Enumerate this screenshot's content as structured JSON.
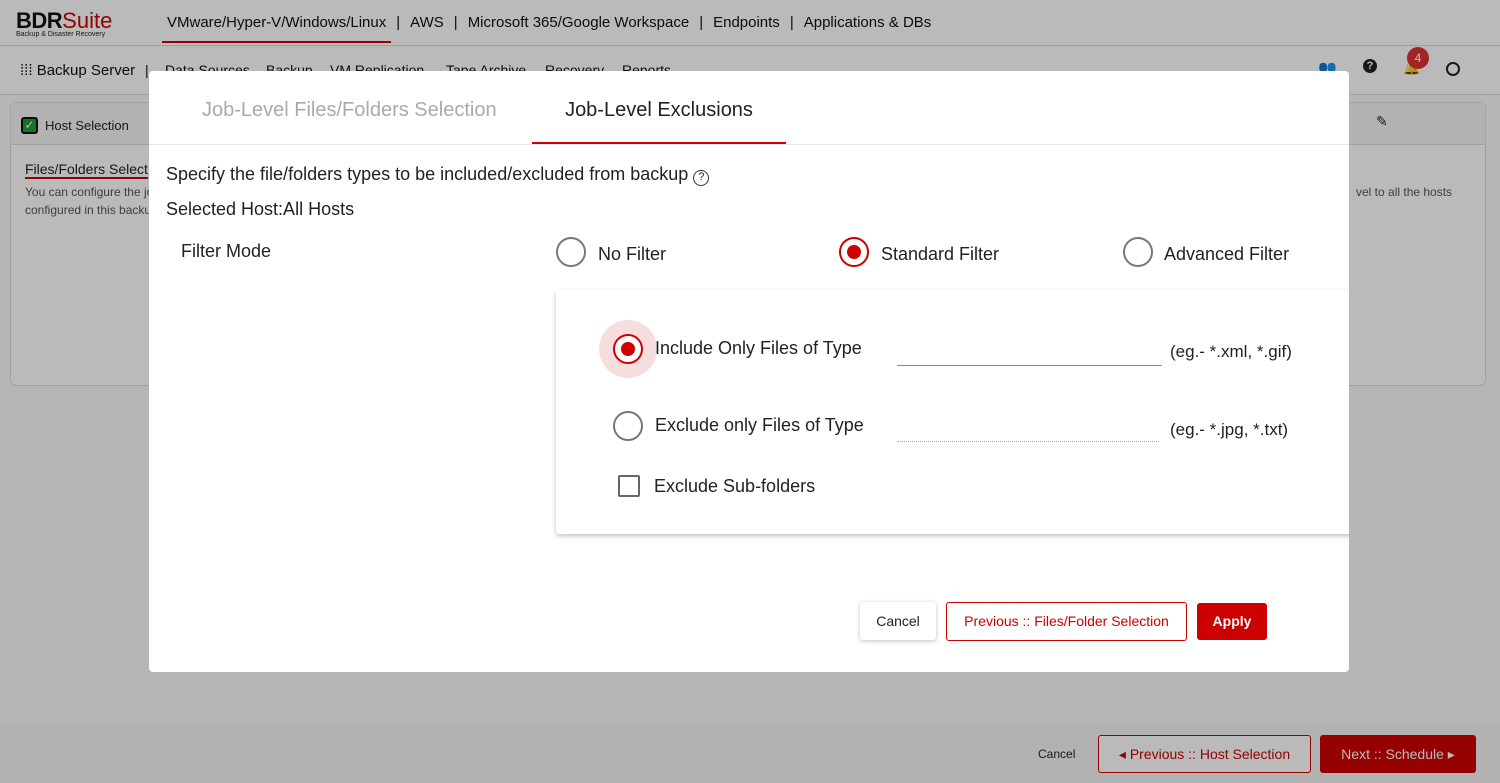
{
  "brand": {
    "name_bold": "BDR",
    "name_light": "Suite",
    "tagline": "Backup & Disaster Recovery"
  },
  "topnav": [
    "VMware/Hyper-V/Windows/Linux",
    "AWS",
    "Microsoft 365/Google Workspace",
    "Endpoints",
    "Applications & DBs"
  ],
  "subnav": {
    "home": "Backup Server",
    "items": [
      "Data Sources",
      "Backup",
      "VM Replication",
      "Tape Archive",
      "Recovery",
      "Reports"
    ]
  },
  "notifications": {
    "count": "4"
  },
  "wizard": {
    "step": "Host Selection",
    "section_title": "Files/Folders Select",
    "desc1": "You can configure the jo",
    "desc2": "configured in this backu",
    "desc_right": "vel to all the hosts"
  },
  "footer": {
    "cancel": "Cancel",
    "previous": "Previous :: Host Selection",
    "next": "Next :: Schedule"
  },
  "modal": {
    "tabs": [
      "Job-Level Files/Folders Selection",
      "Job-Level Exclusions"
    ],
    "active_tab": "Job-Level Exclusions",
    "instruction": "Specify the file/folders types to be included/excluded from backup",
    "selected_host": "Selected Host:All Hosts",
    "filter_mode_label": "Filter Mode",
    "filter_options": [
      "No Filter",
      "Standard Filter",
      "Advanced Filter"
    ],
    "filter_selected": "Standard Filter",
    "include_label": "Include Only Files of Type",
    "include_value": "",
    "include_hint": "(eg.- *.xml, *.gif)",
    "exclude_label": "Exclude only Files of Type",
    "exclude_value": "",
    "exclude_hint": "(eg.- *.jpg, *.txt)",
    "include_selected": true,
    "subfolders_label": "Exclude Sub-folders",
    "subfolders_checked": false,
    "cancel": "Cancel",
    "previous": "Previous :: Files/Folder Selection",
    "apply": "Apply"
  },
  "colors": {
    "accent": "#cc0000"
  }
}
